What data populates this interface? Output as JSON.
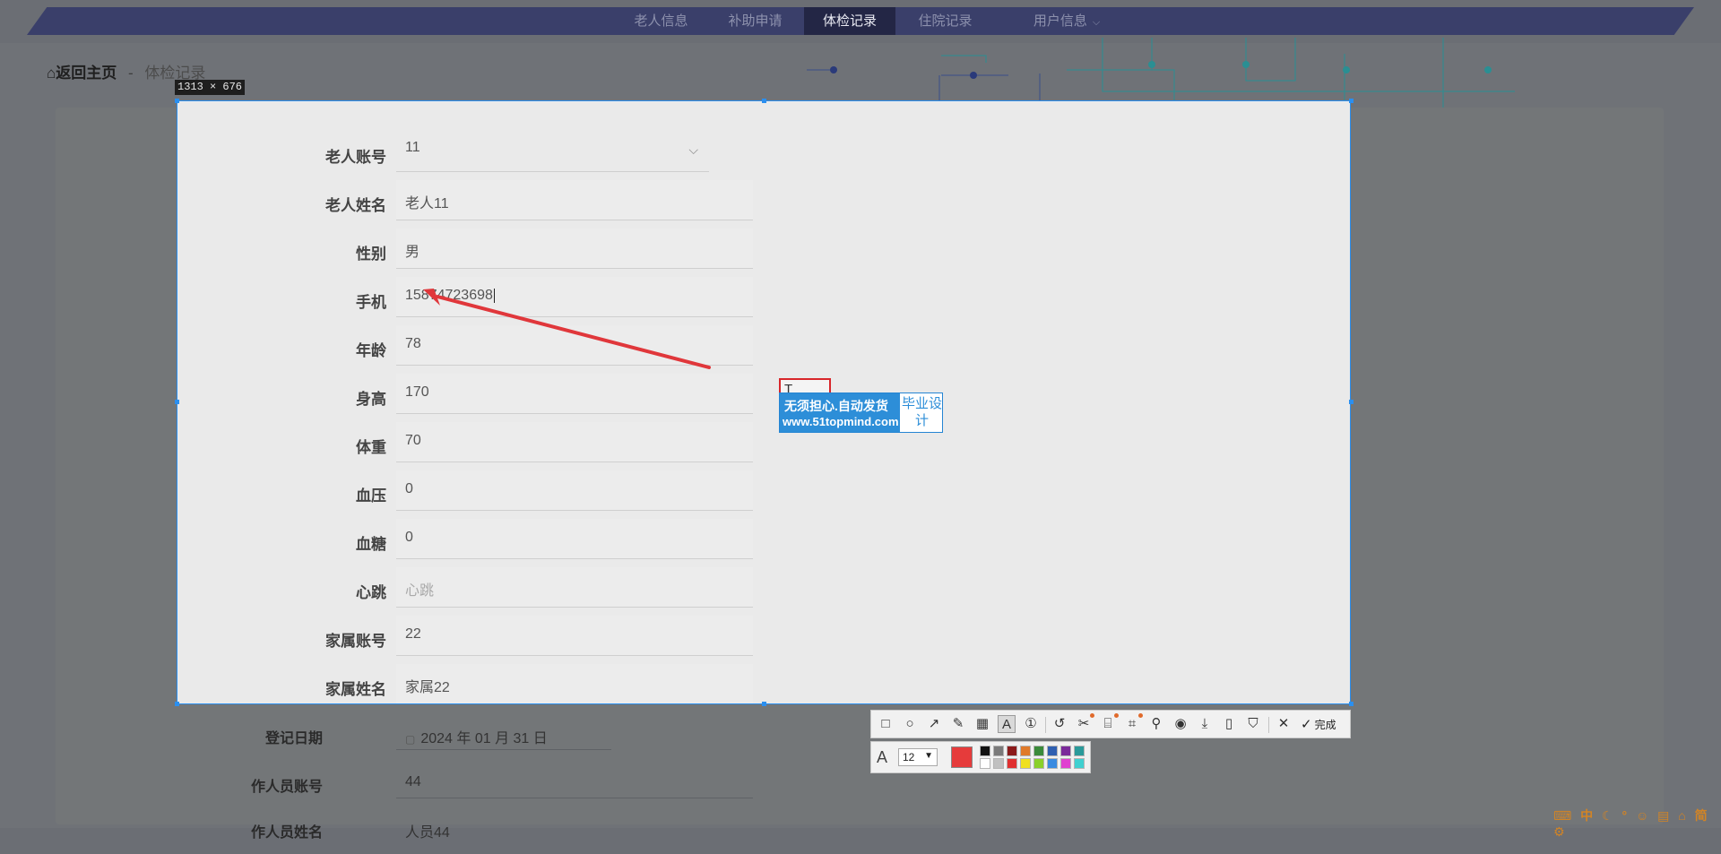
{
  "nav": {
    "items": [
      {
        "label": "老人信息"
      },
      {
        "label": "补助申请"
      },
      {
        "label": "体检记录"
      },
      {
        "label": "住院记录"
      },
      {
        "label": "用户信息"
      }
    ],
    "active_index": 2
  },
  "breadcrumb": {
    "home": "返回主页",
    "separator": "-",
    "current": "体检记录"
  },
  "selection": {
    "size_label": "1313 × 676"
  },
  "form": {
    "fields": [
      {
        "label": "老人账号",
        "value": "11",
        "kind": "select"
      },
      {
        "label": "老人姓名",
        "value": "老人11"
      },
      {
        "label": "性别",
        "value": "男"
      },
      {
        "label": "手机",
        "value": "15874723698"
      },
      {
        "label": "年龄",
        "value": "78"
      },
      {
        "label": "身高",
        "value": "170"
      },
      {
        "label": "体重",
        "value": "70"
      },
      {
        "label": "血压",
        "value": "0"
      },
      {
        "label": "血糖",
        "value": "0"
      },
      {
        "label": "心跳",
        "value": "",
        "placeholder": "心跳"
      },
      {
        "label": "家属账号",
        "value": "22"
      },
      {
        "label": "家属姓名",
        "value": "家属22"
      }
    ],
    "below": [
      {
        "label": "登记日期",
        "value": "2024 年 01 月 31 日"
      },
      {
        "label": "作人员账号",
        "value": "44"
      },
      {
        "label": "作人员姓名",
        "value": "人员44"
      }
    ]
  },
  "annotation": {
    "text_box_content": "T",
    "arrow_color": "#e0373b"
  },
  "ad": {
    "line1": "无须担心.自动发货",
    "line2": "www.51topmind.com",
    "side": "毕业设计"
  },
  "toolbar": {
    "tools": [
      "rectangle-icon",
      "ellipse-icon",
      "arrow-icon",
      "pen-icon",
      "mosaic-icon",
      "text-icon",
      "serial-number-icon",
      "undo-icon",
      "scissors-icon",
      "ocr-icon",
      "scan-icon",
      "pin-icon",
      "record-icon",
      "download-icon",
      "phone-icon",
      "bookmark-icon",
      "close-icon"
    ],
    "done_label": "完成"
  },
  "text_options": {
    "font_size": "12",
    "current_color": "#e63b3b",
    "colors_top": [
      "#111111",
      "#7a7a7a",
      "#8b1a1a",
      "#e07a2a",
      "#3a8a3a",
      "#2f5fb0",
      "#7a2a9a",
      "#2a9a9a"
    ],
    "colors_bottom": [
      "#ffffff",
      "#c0c0c0",
      "#e03030",
      "#f0e020",
      "#8ad02a",
      "#3a8ae0",
      "#e040d0",
      "#40d0d0"
    ]
  },
  "tray": {
    "items": [
      "中",
      "☾",
      "简"
    ]
  }
}
